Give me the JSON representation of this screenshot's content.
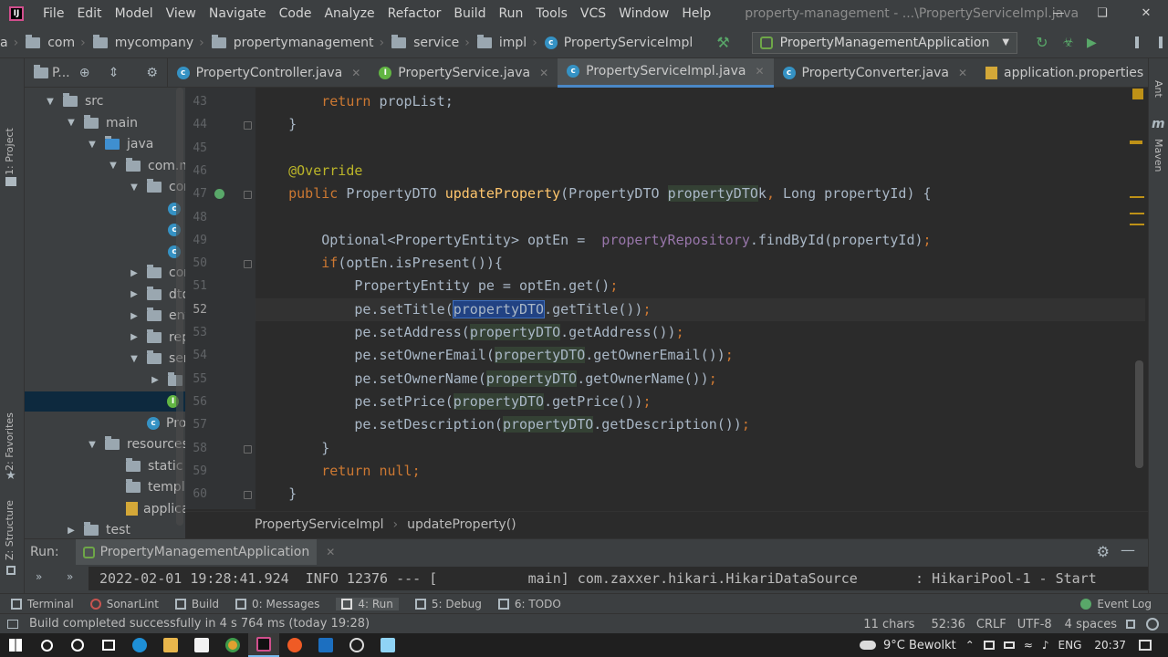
{
  "menu": {
    "items": [
      "File",
      "Edit",
      "Model",
      "View",
      "Navigate",
      "Code",
      "Analyze",
      "Refactor",
      "Build",
      "Run",
      "Tools",
      "VCS",
      "Window",
      "Help"
    ],
    "window_title": "property-management - ...\\PropertyServiceImpl.java"
  },
  "nav": {
    "crumbs": [
      "a",
      "com",
      "mycompany",
      "propertymanagement",
      "service",
      "impl"
    ],
    "class": "PropertyServiceImpl",
    "run_config": "PropertyManagementApplication"
  },
  "left_strip": {
    "project": "1: Project",
    "favorites": "2: Favorites",
    "structure": "Z: Structure"
  },
  "right_strip": {
    "ant": "Ant",
    "maven": "Maven"
  },
  "project_header": "P...",
  "tabs": [
    {
      "label": "PropertyController.java",
      "icon": "class"
    },
    {
      "label": "PropertyService.java",
      "icon": "interface"
    },
    {
      "label": "PropertyServiceImpl.java",
      "icon": "class"
    },
    {
      "label": "PropertyConverter.java",
      "icon": "class"
    },
    {
      "label": "application.properties",
      "icon": "properties"
    }
  ],
  "tree": [
    {
      "label": "src",
      "depth": 0,
      "arrow": "down",
      "icon": "folder"
    },
    {
      "label": "main",
      "depth": 1,
      "arrow": "down",
      "icon": "folder"
    },
    {
      "label": "java",
      "depth": 2,
      "arrow": "down",
      "icon": "folder-blue"
    },
    {
      "label": "com.m",
      "depth": 3,
      "arrow": "down",
      "icon": "package"
    },
    {
      "label": "cor",
      "depth": 4,
      "arrow": "down",
      "icon": "package"
    },
    {
      "label": "",
      "depth": 5,
      "arrow": "",
      "icon": "class"
    },
    {
      "label": "",
      "depth": 5,
      "arrow": "",
      "icon": "class"
    },
    {
      "label": "",
      "depth": 5,
      "arrow": "",
      "icon": "class"
    },
    {
      "label": "cor",
      "depth": 4,
      "arrow": "right",
      "icon": "package"
    },
    {
      "label": "dto",
      "depth": 4,
      "arrow": "right",
      "icon": "package"
    },
    {
      "label": "ent",
      "depth": 4,
      "arrow": "right",
      "icon": "package"
    },
    {
      "label": "rep",
      "depth": 4,
      "arrow": "right",
      "icon": "package"
    },
    {
      "label": "ser",
      "depth": 4,
      "arrow": "down",
      "icon": "package"
    },
    {
      "label": "",
      "depth": 5,
      "arrow": "right",
      "icon": "package"
    },
    {
      "label": "",
      "depth": 5,
      "arrow": "",
      "icon": "interface"
    },
    {
      "label": "Pro",
      "depth": 4,
      "arrow": "",
      "icon": "class"
    },
    {
      "label": "resources",
      "depth": 2,
      "arrow": "down",
      "icon": "folder"
    },
    {
      "label": "static",
      "depth": 3,
      "arrow": "",
      "icon": "folder"
    },
    {
      "label": "templa",
      "depth": 3,
      "arrow": "",
      "icon": "folder"
    },
    {
      "label": "applica",
      "depth": 3,
      "arrow": "",
      "icon": "properties"
    },
    {
      "label": "test",
      "depth": 1,
      "arrow": "right",
      "icon": "folder"
    }
  ],
  "code": {
    "line_numbers": [
      "43",
      "44",
      "45",
      "46",
      "47",
      "48",
      "49",
      "50",
      "51",
      "52",
      "53",
      "54",
      "55",
      "56",
      "57",
      "58",
      "59",
      "60"
    ],
    "current_line": "52",
    "lines": [
      [
        [
          "        ",
          ""
        ],
        [
          "return ",
          "k"
        ],
        [
          "propList;",
          ""
        ]
      ],
      [
        [
          "    }",
          ""
        ]
      ],
      [
        [
          "",
          ""
        ]
      ],
      [
        [
          "    ",
          ""
        ],
        [
          "@Override",
          "a"
        ]
      ],
      [
        [
          "    ",
          ""
        ],
        [
          "public ",
          "k"
        ],
        [
          "PropertyDTO ",
          ""
        ],
        [
          "updateProperty",
          "f"
        ],
        [
          "(PropertyDTO ",
          ""
        ],
        [
          "propertyDTO",
          "u"
        ],
        [
          "k",
          ""
        ],
        [
          ", ",
          "k"
        ],
        [
          "Long propertyId) {",
          ""
        ]
      ],
      [
        [
          "",
          ""
        ]
      ],
      [
        [
          "        Optional<PropertyEntity> optEn =  ",
          ""
        ],
        [
          "propertyRepository",
          "pu"
        ],
        [
          ".findById(propertyId)",
          ""
        ],
        [
          ";",
          "k"
        ]
      ],
      [
        [
          "        ",
          ""
        ],
        [
          "if",
          "k"
        ],
        [
          "(optEn.isPresent()){",
          ""
        ]
      ],
      [
        [
          "            PropertyEntity pe = optEn.get()",
          ""
        ],
        [
          ";",
          "k"
        ]
      ],
      [
        [
          "            pe.setTitle(",
          ""
        ],
        [
          "propertyDTO",
          "selw"
        ],
        [
          ".getTitle())",
          ""
        ],
        [
          ";",
          "k"
        ]
      ],
      [
        [
          "            pe.setAddress(",
          ""
        ],
        [
          "propertyDTO",
          "u"
        ],
        [
          ".getAddress())",
          ""
        ],
        [
          ";",
          "k"
        ]
      ],
      [
        [
          "            pe.setOwnerEmail(",
          ""
        ],
        [
          "propertyDTO",
          "u"
        ],
        [
          ".getOwnerEmail())",
          ""
        ],
        [
          ";",
          "k"
        ]
      ],
      [
        [
          "            pe.setOwnerName(",
          ""
        ],
        [
          "propertyDTO",
          "u"
        ],
        [
          ".getOwnerName())",
          ""
        ],
        [
          ";",
          "k"
        ]
      ],
      [
        [
          "            pe.setPrice(",
          ""
        ],
        [
          "propertyDTO",
          "u"
        ],
        [
          ".getPrice())",
          ""
        ],
        [
          ";",
          "k"
        ]
      ],
      [
        [
          "            pe.setDescription(",
          ""
        ],
        [
          "propertyDTO",
          "u"
        ],
        [
          ".getDescription())",
          ""
        ],
        [
          ";",
          "k"
        ]
      ],
      [
        [
          "        }",
          ""
        ]
      ],
      [
        [
          "        ",
          ""
        ],
        [
          "return null",
          "k"
        ],
        [
          ";",
          "k"
        ]
      ],
      [
        [
          "    }",
          ""
        ]
      ]
    ]
  },
  "breadcrumbs": [
    "PropertyServiceImpl",
    "updateProperty()"
  ],
  "run": {
    "label": "Run:",
    "tab": "PropertyManagementApplication",
    "console": "2022-02-01 19:28:41.924  INFO 12376 --- [           main] com.zaxxer.hikari.HikariDataSource       : HikariPool-1 - Start"
  },
  "toolwindows": [
    {
      "label": "Terminal",
      "icon": "terminal-icon"
    },
    {
      "label": "SonarLint",
      "icon": "sonarlint-icon"
    },
    {
      "label": "Build",
      "icon": "build-icon"
    },
    {
      "label": "0: Messages",
      "icon": "messages-icon"
    },
    {
      "label": "4: Run",
      "icon": "run-icon"
    },
    {
      "label": "5: Debug",
      "icon": "debug-icon"
    },
    {
      "label": "6: TODO",
      "icon": "todo-icon"
    }
  ],
  "event_log": "Event Log",
  "status": {
    "message": "Build completed successfully in 4 s 764 ms (today 19:28)",
    "chars": "11 chars",
    "position": "52:36",
    "line_sep": "CRLF",
    "encoding": "UTF-8",
    "indent": "4 spaces"
  },
  "taskbar": {
    "weather": "9°C Bewolkt",
    "lang": "ENG",
    "time": "20:37"
  }
}
